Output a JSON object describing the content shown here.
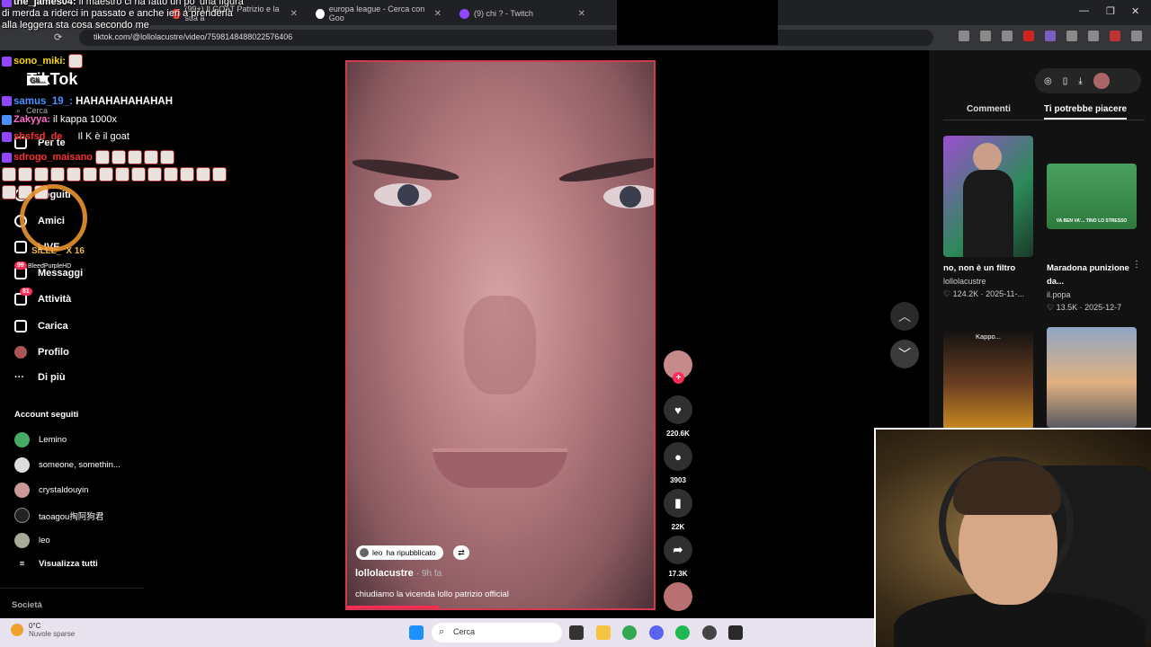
{
  "browser": {
    "tabs": [
      {
        "label": "(99+) Il GOAT Patrizio e la sua a"
      },
      {
        "label": "europa league - Cerca con Goo"
      },
      {
        "label": "(9) chi ? - Twitch"
      }
    ],
    "url": "tiktok.com/@lollolacustre/video/7598148488022576406"
  },
  "chat": [
    {
      "user": "the_james04:",
      "msg": "il maestro ci ha fatto un po' una figura di merda a riderci in passato e anche ieri a prenderla alla leggera sta cosa secondo me",
      "color": "#ffffff"
    },
    {
      "user": "sono_miki:",
      "msg": "",
      "color": "#ffd700"
    },
    {
      "user": "samus_19_:",
      "msg": "HAHAHAHAHAHAH",
      "color": "#4a90ff"
    },
    {
      "user": "Zakyya:",
      "msg": "il kappa 1000x",
      "color": "#ff6ec7"
    },
    {
      "user": "shsfsd_de",
      "msg": "Il K è il goat",
      "color": "#ff3030"
    },
    {
      "user": "sdrogo_maisano",
      "msg": "",
      "color": "#ff3030"
    }
  ],
  "overlay": {
    "sub_name": "SILLL_",
    "sub_count": "X 16",
    "sub_user": "BleedPurpleHD"
  },
  "tiktok": {
    "logo": "TikTok",
    "search_placeholder": "Cerca",
    "nav": [
      {
        "label": "Per te",
        "icon": "home-icon"
      },
      {
        "label": "Seguiti",
        "icon": "following-icon"
      },
      {
        "label": "Amici",
        "icon": "friends-icon"
      },
      {
        "label": "LIVE",
        "icon": "live-icon"
      },
      {
        "label": "Messaggi",
        "icon": "messages-icon",
        "badge": "99"
      },
      {
        "label": "Attività",
        "icon": "activity-icon",
        "badge": "81"
      },
      {
        "label": "Carica",
        "icon": "upload-icon"
      },
      {
        "label": "Profilo",
        "icon": "profile-icon"
      },
      {
        "label": "Di più",
        "icon": "more-icon"
      }
    ],
    "accounts_title": "Account seguiti",
    "accounts": [
      "Lemino",
      "someone, somethin...",
      "crystaldouyin",
      "taoagou掏阿狗君",
      "leo"
    ],
    "view_all": "Visualizza tutti",
    "footer": "Società",
    "video": {
      "repost_user": "leo",
      "repost_label": "ha ripubblicato",
      "author": "lollolacustre",
      "time": "· 9h fa",
      "caption": "chiudiamo la vicenda lollo patrizio official",
      "progress": 0.3
    },
    "actions": {
      "likes": "220.6K",
      "comments": "3903",
      "saves": "22K",
      "shares": "17.3K"
    },
    "tabs": {
      "comments": "Commenti",
      "suggested": "Ti potrebbe piacere"
    },
    "suggested": [
      {
        "title": "no, non è un filtro",
        "author": "lollolacustre",
        "likes": "124.2K",
        "date": "2025-11-..."
      },
      {
        "title": "Maradona punizione da...",
        "author": "il.popa",
        "likes": "13.5K",
        "date": "2025-12-7",
        "thumb_text": "VA BEN VA'... TINO LO STRESSO"
      },
      {
        "title": "",
        "author": "",
        "thumb_text": "Kappo..."
      },
      {
        "title": "",
        "author": ""
      }
    ]
  },
  "taskbar": {
    "temp": "0°C",
    "weather": "Nuvole sparse",
    "search": "Cerca"
  }
}
